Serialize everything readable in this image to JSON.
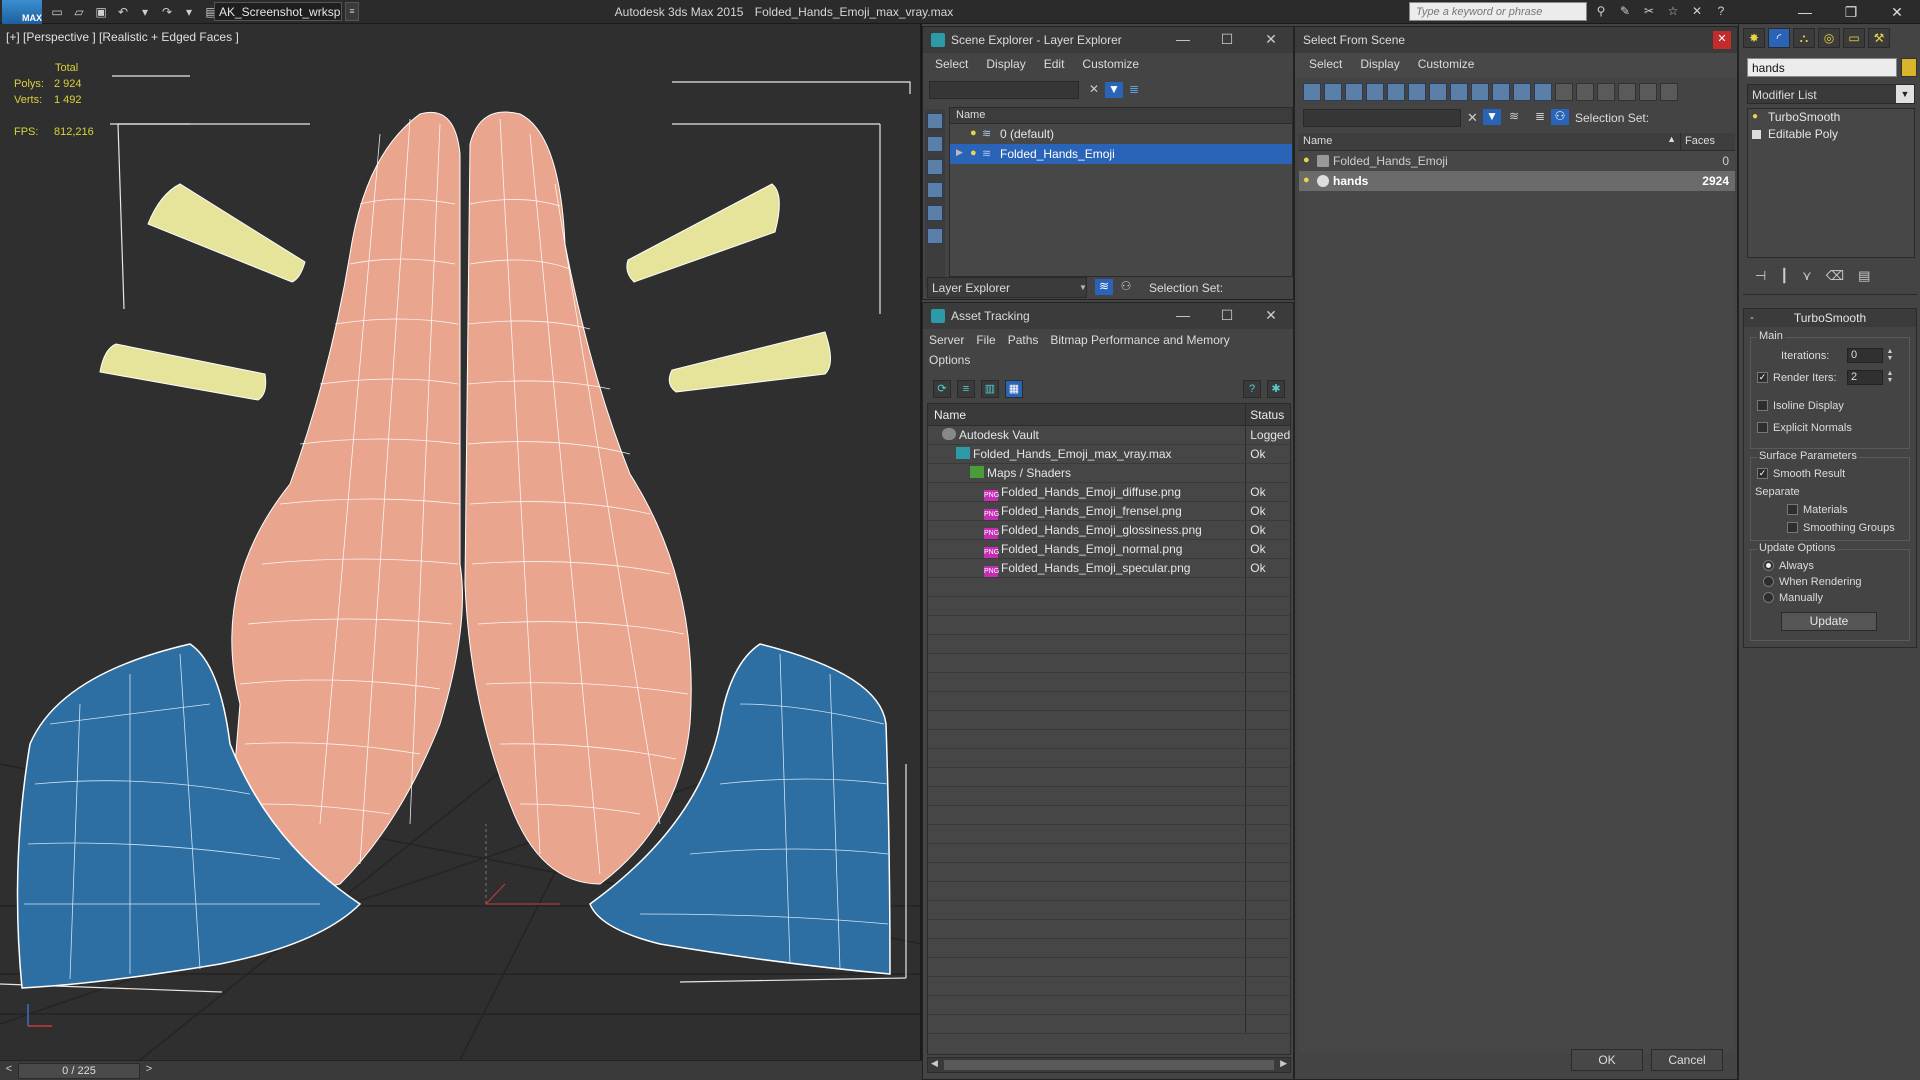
{
  "app": {
    "logo_text": "MAX",
    "workspace": "AK_Screenshot_wrksp",
    "app_name": "Autodesk 3ds Max  2015",
    "file_name": "Folded_Hands_Emoji_max_vray.max",
    "search_placeholder": "Type a keyword or phrase"
  },
  "viewport": {
    "label": "[+] [Perspective ] [Realistic + Edged Faces ]",
    "stats_header": "Total",
    "polys_label": "Polys:",
    "polys_value": "2 924",
    "verts_label": "Verts:",
    "verts_value": "1 492",
    "fps_label": "FPS:",
    "fps_value": "812,216",
    "timeline": "0 / 225"
  },
  "scene_explorer": {
    "title": "Scene Explorer - Layer Explorer",
    "menu": [
      "Select",
      "Display",
      "Edit",
      "Customize"
    ],
    "column_name": "Name",
    "rows": [
      {
        "name": "0 (default)",
        "selected": false
      },
      {
        "name": "Folded_Hands_Emoji",
        "selected": true
      }
    ],
    "footer_select": "Layer Explorer",
    "selection_set_label": "Selection Set:"
  },
  "asset_tracking": {
    "title": "Asset Tracking",
    "menu": [
      "Server",
      "File",
      "Paths",
      "Bitmap Performance and Memory",
      "Options"
    ],
    "col_name": "Name",
    "col_status": "Status",
    "rows": [
      {
        "name": "Autodesk Vault",
        "status": "Logged",
        "indent": 1,
        "icon": "vault"
      },
      {
        "name": "Folded_Hands_Emoji_max_vray.max",
        "status": "Ok",
        "indent": 2,
        "icon": "max"
      },
      {
        "name": "Maps / Shaders",
        "status": "",
        "indent": 3,
        "icon": "maps"
      },
      {
        "name": "Folded_Hands_Emoji_diffuse.png",
        "status": "Ok",
        "indent": 4,
        "icon": "png"
      },
      {
        "name": "Folded_Hands_Emoji_frensel.png",
        "status": "Ok",
        "indent": 4,
        "icon": "png"
      },
      {
        "name": "Folded_Hands_Emoji_glossiness.png",
        "status": "Ok",
        "indent": 4,
        "icon": "png"
      },
      {
        "name": "Folded_Hands_Emoji_normal.png",
        "status": "Ok",
        "indent": 4,
        "icon": "png"
      },
      {
        "name": "Folded_Hands_Emoji_specular.png",
        "status": "Ok",
        "indent": 4,
        "icon": "png"
      }
    ]
  },
  "select_from_scene": {
    "title": "Select From Scene",
    "menu": [
      "Select",
      "Display",
      "Customize"
    ],
    "selection_set_label": "Selection Set:",
    "col_name": "Name",
    "col_faces": "Faces",
    "rows": [
      {
        "name": "Folded_Hands_Emoji",
        "faces": "0",
        "selected": false
      },
      {
        "name": "hands",
        "faces": "2924",
        "selected": true
      }
    ],
    "ok_label": "OK",
    "cancel_label": "Cancel"
  },
  "command_panel": {
    "object_name": "hands",
    "object_color": "#d9b52c",
    "modifier_list": "Modifier List",
    "stack": [
      "TurboSmooth",
      "Editable Poly"
    ],
    "rollout_title": "TurboSmooth",
    "main_group": "Main",
    "iterations_label": "Iterations:",
    "iterations_value": "0",
    "render_iters_label": "Render Iters:",
    "render_iters_value": "2",
    "render_iters_checked": true,
    "isoline_label": "Isoline Display",
    "explicit_normals_label": "Explicit Normals",
    "surface_group": "Surface Parameters",
    "smooth_result_label": "Smooth Result",
    "separate_label": "Separate",
    "materials_label": "Materials",
    "smoothing_groups_label": "Smoothing Groups",
    "update_group": "Update Options",
    "always_label": "Always",
    "when_rendering_label": "When Rendering",
    "manually_label": "Manually",
    "update_button": "Update"
  },
  "colors": {
    "skin": "#e9a58d",
    "sleeve": "#2e6fa3",
    "sparkle": "#e6e39a",
    "stats": "#d8d23c",
    "selection": "#2a64b8"
  }
}
